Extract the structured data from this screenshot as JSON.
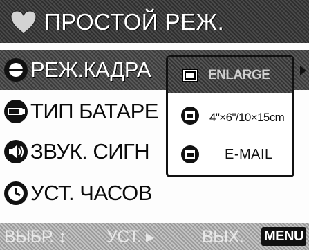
{
  "header": {
    "title": "ПРОСТОЙ РЕЖ.",
    "icon": "heart-icon"
  },
  "menu": {
    "items": [
      {
        "label": "РЕЖ.КАДРА",
        "icon": "camera-mode-icon",
        "selected": true
      },
      {
        "label": "ТИП БАТАРЕ",
        "icon": "battery-icon",
        "selected": false
      },
      {
        "label": "ЗВУК. СИГН",
        "icon": "speaker-icon",
        "selected": false
      },
      {
        "label": "УСТ. ЧАСОВ",
        "icon": "clock-icon",
        "selected": false
      }
    ]
  },
  "submenu": {
    "items": [
      {
        "label": "ENLARGE",
        "icon": "enlarge-icon",
        "selected": true
      },
      {
        "label": "4\"×6\"/10×15cm",
        "icon": "print-size-icon",
        "selected": false
      },
      {
        "label": "E-MAIL",
        "icon": "email-icon",
        "selected": false
      }
    ]
  },
  "footer": {
    "select": "ВЫБР.",
    "set": "УСТ.",
    "exit": "ВЫХ.",
    "menu_button": "MENU"
  },
  "colors": {
    "highlight": "#444444",
    "background": "#ffffff",
    "text": "#111111"
  }
}
